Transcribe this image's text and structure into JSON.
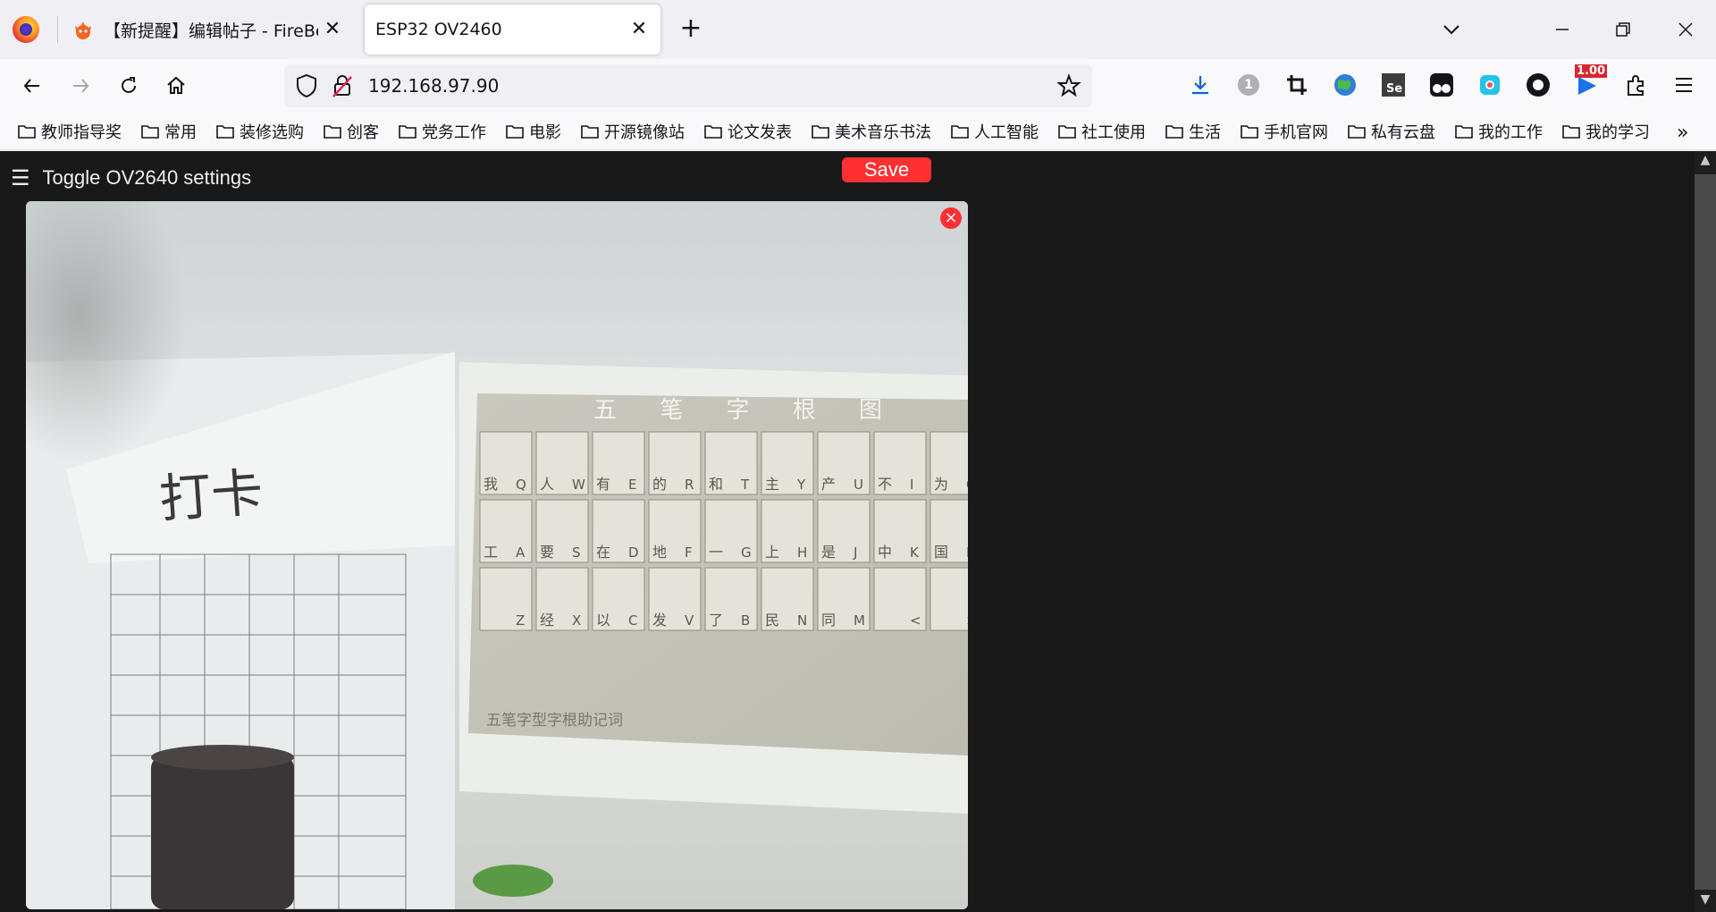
{
  "browser": {
    "tabs": [
      {
        "title": "【新提醒】编辑帖子 - FireBeetle",
        "close": "✕"
      },
      {
        "title": "ESP32 OV2460",
        "close": "✕"
      }
    ],
    "new_tab": "+",
    "url": "192.168.97.90",
    "extension_badge": "1.00",
    "download_count": "1"
  },
  "bookmarks": [
    {
      "label": "教师指导奖"
    },
    {
      "label": "常用"
    },
    {
      "label": "装修选购"
    },
    {
      "label": "创客"
    },
    {
      "label": "党务工作"
    },
    {
      "label": "电影"
    },
    {
      "label": "开源镜像站"
    },
    {
      "label": "论文发表"
    },
    {
      "label": "美术音乐书法"
    },
    {
      "label": "人工智能"
    },
    {
      "label": "社工使用"
    },
    {
      "label": "生活"
    },
    {
      "label": "手机官网"
    },
    {
      "label": "私有云盘"
    },
    {
      "label": "我的工作"
    },
    {
      "label": "我的学习"
    }
  ],
  "bookmarks_more": "»",
  "page": {
    "toggle_icon": "☰",
    "toggle_label": "Toggle OV2640 settings",
    "save_label": "Save",
    "close_label": "×"
  },
  "camera_scene": {
    "note_text": "打卡",
    "chart_title": "五 笔 字 根 图",
    "chart_footer": "五笔字型字根助记词",
    "keys_row1": [
      [
        "Q",
        "我"
      ],
      [
        "W",
        "人"
      ],
      [
        "E",
        "有"
      ],
      [
        "R",
        "的"
      ],
      [
        "T",
        "和"
      ],
      [
        "Y",
        "主"
      ],
      [
        "U",
        "产"
      ],
      [
        "I",
        "不"
      ],
      [
        "O",
        "为"
      ]
    ],
    "keys_row2": [
      [
        "A",
        "工"
      ],
      [
        "S",
        "要"
      ],
      [
        "D",
        "在"
      ],
      [
        "F",
        "地"
      ],
      [
        "G",
        "一"
      ],
      [
        "H",
        "上"
      ],
      [
        "J",
        "是"
      ],
      [
        "K",
        "中"
      ],
      [
        "L",
        "国"
      ]
    ],
    "keys_row3": [
      [
        "Z",
        ""
      ],
      [
        "X",
        "经"
      ],
      [
        "C",
        "以"
      ],
      [
        "V",
        "发"
      ],
      [
        "B",
        "了"
      ],
      [
        "N",
        "民"
      ],
      [
        "M",
        "同"
      ],
      [
        "<",
        ""
      ],
      [
        ">",
        ""
      ]
    ]
  },
  "colors": {
    "accent": "#ff3034",
    "page_bg": "#181818",
    "text": "#efefef"
  }
}
